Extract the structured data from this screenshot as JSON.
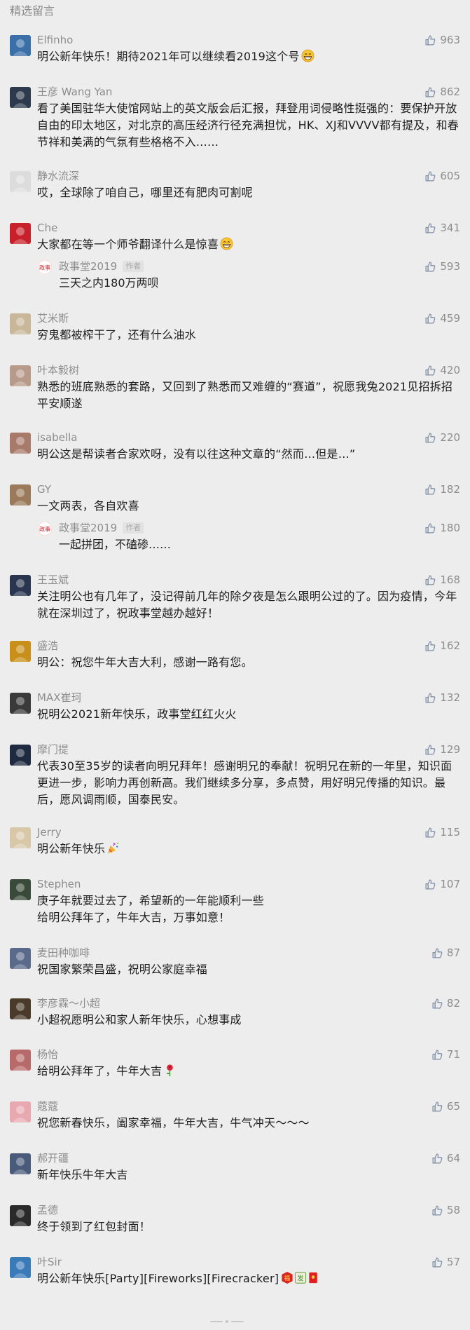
{
  "section_title": "精选留言",
  "author_badge": "作者",
  "comments": [
    {
      "name": "Elfinho",
      "likes": "963",
      "text": "明公新年快乐！期待2021年可以继续看2019这个号",
      "emoji": "grin-emoji",
      "avatar_color": "#3a6fa8"
    },
    {
      "name": "王彦 Wang Yan",
      "likes": "862",
      "text": "看了美国驻华大使馆网站上的英文版会后汇报，拜登用词侵略性挺强的：要保护开放自由的印太地区，对北京的高压经济行径充满担忧，HK、XJ和VVVV都有提及，和春节祥和美满的气氛有些格格不入……",
      "avatar_color": "#2d3a4e"
    },
    {
      "name": "静水流深",
      "likes": "605",
      "text": "哎，全球除了咱自己，哪里还有肥肉可割呢",
      "avatar_color": "#dcdcdc"
    },
    {
      "name": "Che",
      "likes": "341",
      "text": "大家都在等一个师爷翻译什么是惊喜",
      "emoji": "grin-emoji",
      "avatar_color": "#c8202a",
      "reply": {
        "name": "政事堂2019",
        "likes": "593",
        "text": "三天之内180万两呗"
      }
    },
    {
      "name": "艾米斯",
      "likes": "459",
      "text": "穷鬼都被榨干了，还有什么油水",
      "avatar_color": "#c9b79a"
    },
    {
      "name": "叶本毅树",
      "likes": "420",
      "text": "熟悉的班底熟悉的套路，又回到了熟悉而又难缠的“赛道”，祝愿我兔2021见招拆招平安顺遂",
      "avatar_color": "#b89a8a"
    },
    {
      "name": "isabella",
      "likes": "220",
      "text": "明公这是帮读者合家欢呀，没有以往这种文章的“然而…但是…”",
      "avatar_color": "#a87a6a"
    },
    {
      "name": "GY",
      "likes": "182",
      "text": "一文两表，各自欢喜",
      "avatar_color": "#9a7a5a",
      "reply": {
        "name": "政事堂2019",
        "likes": "180",
        "text": "一起拼团，不磕碜……"
      }
    },
    {
      "name": "王玉斌",
      "likes": "168",
      "text": "关注明公也有几年了，没记得前几年的除夕夜是怎么跟明公过的了。因为疫情，今年就在深圳过了，祝政事堂越办越好！",
      "avatar_color": "#2a3550"
    },
    {
      "name": "盛浩",
      "likes": "162",
      "text": "明公：祝您牛年大吉大利，感谢一路有您。",
      "avatar_color": "#c8901a"
    },
    {
      "name": "MAX崔珂",
      "likes": "132",
      "text": "祝明公2021新年快乐，政事堂红红火火",
      "avatar_color": "#3a3a3a"
    },
    {
      "name": "摩门提",
      "likes": "129",
      "text": "代表30至35岁的读者向明兄拜年！感谢明兄的奉献！祝明兄在新的一年里，知识面更进一步，影响力再创新高。我们继续多分享，多点赞，用好明兄传播的知识。最后，愿风调雨顺，国泰民安。",
      "avatar_color": "#1e2a40"
    },
    {
      "name": "Jerry",
      "likes": "115",
      "text": "明公新年快乐",
      "emoji": "party-popper-emoji",
      "avatar_color": "#d8c8a8"
    },
    {
      "name": "Stephen",
      "likes": "107",
      "text": "庚子年就要过去了，希望新的一年能顺利一些\n给明公拜年了，牛年大吉，万事如意！",
      "avatar_color": "#3a4a3a"
    },
    {
      "name": "麦田种咖啡",
      "likes": "87",
      "text": "祝国家繁荣昌盛，祝明公家庭幸福",
      "avatar_color": "#5a6a8a"
    },
    {
      "name": "李彦霖～小超",
      "likes": "82",
      "text": "小超祝愿明公和家人新年快乐，心想事成",
      "avatar_color": "#4a3a2a"
    },
    {
      "name": "杨怡",
      "likes": "71",
      "text": "给明公拜年了，牛年大吉",
      "emoji": "rose-emoji",
      "avatar_color": "#b86a6a"
    },
    {
      "name": "蔻蔻",
      "likes": "65",
      "text": "祝您新春快乐，阖家幸福，牛年大吉，牛气冲天～～～",
      "avatar_color": "#e8a8b0"
    },
    {
      "name": "郝开疆",
      "likes": "64",
      "text": "新年快乐牛年大吉",
      "avatar_color": "#4a5a7a"
    },
    {
      "name": "孟德",
      "likes": "58",
      "text": "终于领到了红包封面！",
      "avatar_color": "#2a2a2a"
    },
    {
      "name": "叶Sir",
      "likes": "57",
      "text": "明公新年快乐[Party][Fireworks][Firecracker]",
      "emoji": "fu-red-envelope-emoji",
      "avatar_color": "#3a7ab8"
    }
  ]
}
